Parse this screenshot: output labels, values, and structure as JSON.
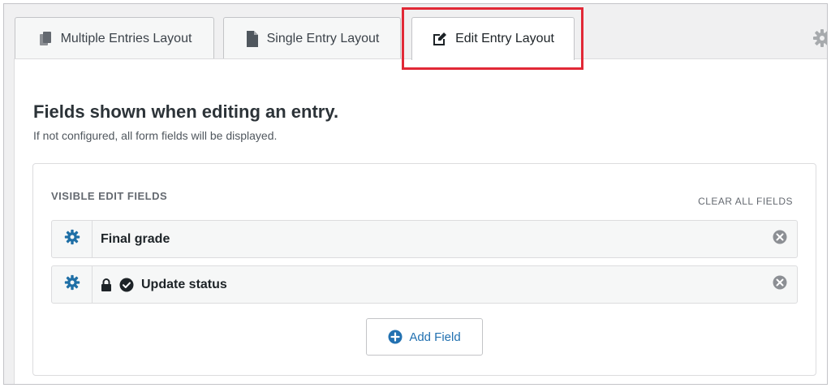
{
  "tabs": [
    {
      "label": "Multiple Entries Layout",
      "icon": "copy-icon",
      "active": false
    },
    {
      "label": "Single Entry Layout",
      "icon": "document-icon",
      "active": false
    },
    {
      "label": "Edit Entry Layout",
      "icon": "edit-icon",
      "active": true
    }
  ],
  "settings_icon": "gear-icon",
  "main": {
    "title": "Fields shown when editing an entry.",
    "subtitle": "If not configured, all form fields will be displayed."
  },
  "fields_card": {
    "title": "VISIBLE EDIT FIELDS",
    "clear_all_label": "CLEAR ALL FIELDS",
    "fields": [
      {
        "label": "Final grade",
        "icons": []
      },
      {
        "label": "Update status",
        "icons": [
          "lock-icon",
          "check-circle-icon"
        ]
      }
    ],
    "add_field_label": "Add Field"
  },
  "colors": {
    "accent": "#2271b1",
    "settings_gear": "#1f6fa6",
    "highlight": "#e12836"
  }
}
